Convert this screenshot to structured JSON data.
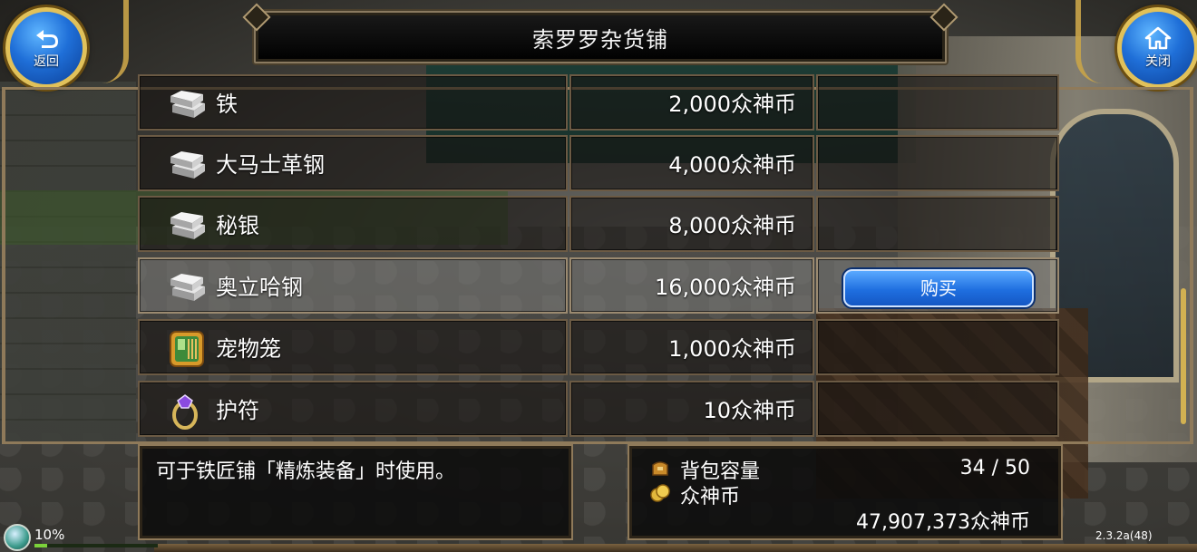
{
  "header": {
    "title": "索罗罗杂货铺",
    "back_label": "返回",
    "close_label": "关闭"
  },
  "shop": {
    "items": [
      {
        "name": "铁",
        "price": "2,000众神币",
        "icon": "iron-ingot-icon"
      },
      {
        "name": "大马士革钢",
        "price": "4,000众神币",
        "icon": "iron-ingot-icon"
      },
      {
        "name": "秘银",
        "price": "8,000众神币",
        "icon": "iron-ingot-icon"
      },
      {
        "name": "奥立哈钢",
        "price": "16,000众神币",
        "icon": "iron-ingot-icon",
        "selected": true
      },
      {
        "name": "宠物笼",
        "price": "1,000众神币",
        "icon": "pet-cage-icon"
      },
      {
        "name": "护符",
        "price": "10众神币",
        "icon": "amulet-icon"
      }
    ],
    "buy_label": "购买"
  },
  "description": {
    "text": "可于铁匠铺「精炼装备」时使用。"
  },
  "inventory": {
    "capacity_label": "背包容量",
    "capacity_value": "34 / 50",
    "currency_label": "众神币",
    "currency_value": "47,907,373众神币"
  },
  "status": {
    "progress_text": "10%",
    "progress_fraction": 0.1,
    "version": "2.3.2a(48)"
  },
  "colors": {
    "accent_gold": "#c9a449",
    "button_blue": "#1f6fe0",
    "frame_brown": "#8f7a5a"
  }
}
